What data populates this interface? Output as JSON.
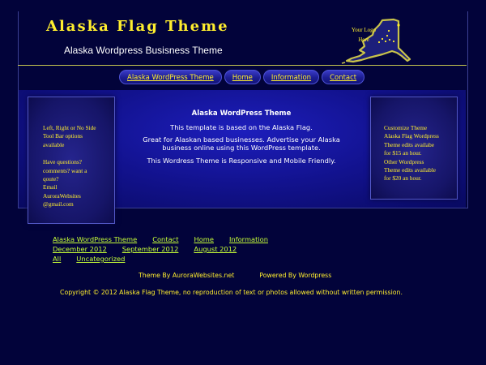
{
  "header": {
    "title": "Alaska Flag Theme",
    "tagline": "Alaska Wordpress Busisness Theme",
    "logo_text_line1": "Your Logo",
    "logo_text_line2": "Here"
  },
  "nav": {
    "items": [
      {
        "label": "Alaska WordPress Theme"
      },
      {
        "label": "Home"
      },
      {
        "label": "Information"
      },
      {
        "label": "Contact"
      }
    ]
  },
  "sidebar_left": {
    "line1": "Left, Right or No Side",
    "line2": "Tool Bar options",
    "line3": "available",
    "line4": "Have questions?",
    "line5": "comments? want a",
    "line6": "qoute?",
    "line7": "Email",
    "line8": "AuroraWebsites",
    "line9": "@gmail.com"
  },
  "sidebar_right": {
    "line1": "Customize Theme",
    "line2": "Alaska Flag Wordpress",
    "line3": "Theme edits availabe",
    "line4": "for $15 an hour.",
    "line5": "Other Wordpress",
    "line6": "Theme edits available",
    "line7": "for $20 an hour."
  },
  "content": {
    "heading": "Alaska WordPress Theme",
    "para1": "This template is based on the Alaska Flag.",
    "para2": "Great for Alaskan based businesses. Advertise your Alaska business online using this WordPress template.",
    "para3": "This Wordress Theme is Responsive and Mobile Friendly."
  },
  "footer": {
    "pages": [
      "Alaska WordPress Theme",
      "Contact",
      "Home",
      "Information"
    ],
    "archives": [
      "December 2012",
      "September 2012",
      "August 2012"
    ],
    "categories": [
      "All",
      "Uncategorized"
    ],
    "theme_by": "Theme By  AuroraWebsites.net",
    "powered_by": "Powered By  Wordpress",
    "copyright": "Copyright © 2012 Alaska Flag Theme, no reproduction of text or photos allowed without written permission."
  },
  "colors": {
    "background": "#02033a",
    "title_yellow": "#ffee2e",
    "link_green": "#c7ff38",
    "nav_blue": "#1c1d92"
  },
  "icons": {
    "logo": "alaska-map-with-big-dipper-logo"
  }
}
